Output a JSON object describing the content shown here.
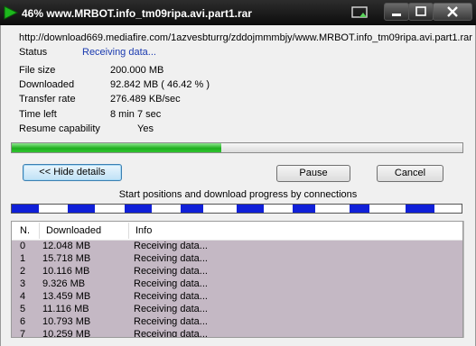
{
  "window": {
    "title": "46% www.MRBOT.info_tm09ripa.avi.part1.rar",
    "icons": {
      "app": "play-arrow-icon",
      "tray": "hide-to-tray-icon",
      "minimize": "minimize-icon",
      "maximize": "maximize-icon",
      "close": "close-icon"
    }
  },
  "details": {
    "url": "http://download669.mediafire.com/1azvesbturrg/zddojmmmbjy/www.MRBOT.info_tm09ripa.avi.part1.rar",
    "status_label": "Status",
    "status_value": "Receiving data...",
    "file_size_label": "File size",
    "file_size_value": "200.000  MB",
    "downloaded_label": "Downloaded",
    "downloaded_value": "92.842  MB  ( 46.42 % )",
    "transfer_rate_label": "Transfer rate",
    "transfer_rate_value": "276.489  KB/sec",
    "time_left_label": "Time left",
    "time_left_value": "8 min 7 sec",
    "resume_label": "Resume capability",
    "resume_value": "Yes"
  },
  "progress": {
    "fraction": 0.4642
  },
  "buttons": {
    "hide_details": "<< Hide details",
    "pause": "Pause",
    "cancel": "Cancel"
  },
  "connections": {
    "caption": "Start positions and download progress by connections",
    "colors": {
      "done": "#1020d8",
      "remaining": "#ffffff"
    },
    "segments": [
      {
        "start": 0.0,
        "end": 0.06
      },
      {
        "start": 0.125,
        "end": 0.185
      },
      {
        "start": 0.25,
        "end": 0.31
      },
      {
        "start": 0.375,
        "end": 0.425
      },
      {
        "start": 0.5,
        "end": 0.56
      },
      {
        "start": 0.625,
        "end": 0.675
      },
      {
        "start": 0.75,
        "end": 0.795
      },
      {
        "start": 0.875,
        "end": 0.94
      }
    ]
  },
  "table": {
    "columns": [
      "N.",
      "Downloaded",
      "Info"
    ],
    "rows": [
      {
        "n": "0",
        "downloaded": "12.048  MB",
        "info": "Receiving data..."
      },
      {
        "n": "1",
        "downloaded": "15.718  MB",
        "info": "Receiving data..."
      },
      {
        "n": "2",
        "downloaded": "10.116  MB",
        "info": "Receiving data..."
      },
      {
        "n": "3",
        "downloaded": "9.326  MB",
        "info": "Receiving data..."
      },
      {
        "n": "4",
        "downloaded": "13.459  MB",
        "info": "Receiving data..."
      },
      {
        "n": "5",
        "downloaded": "11.116  MB",
        "info": "Receiving data..."
      },
      {
        "n": "6",
        "downloaded": "10.793  MB",
        "info": "Receiving data..."
      },
      {
        "n": "7",
        "downloaded": "10.259  MB",
        "info": "Receiving data..."
      }
    ],
    "row_color": "#c4b8c4"
  }
}
